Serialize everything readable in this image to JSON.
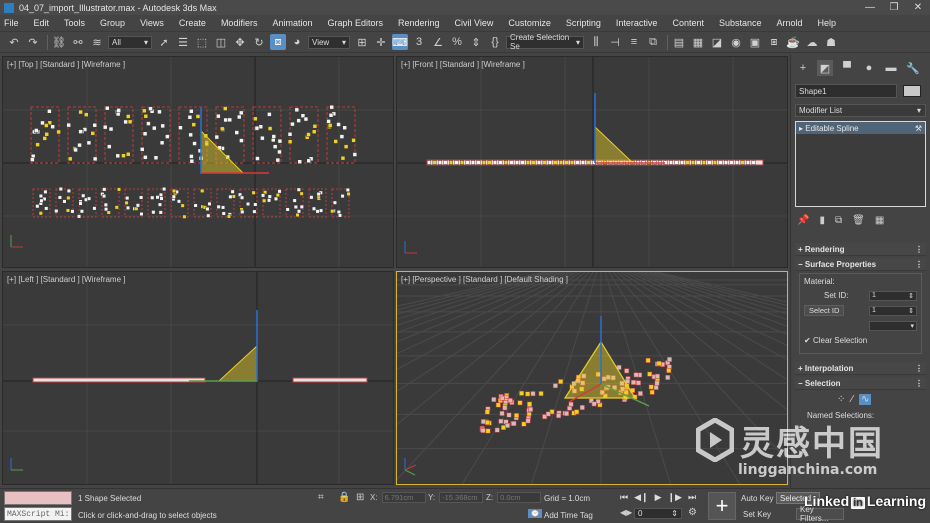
{
  "window": {
    "title": "04_07_import_Illustrator.max - Autodesk 3ds Max",
    "min": "—",
    "restore": "❐",
    "close": "✕"
  },
  "menu": [
    "File",
    "Edit",
    "Tools",
    "Group",
    "Views",
    "Create",
    "Modifiers",
    "Animation",
    "Graph Editors",
    "Rendering",
    "Civil View",
    "Customize",
    "Scripting",
    "Interactive",
    "Content",
    "Substance",
    "Arnold",
    "Help"
  ],
  "toolbar": {
    "filter": "All",
    "refcoord": "View",
    "selection_set": "Create Selection Se"
  },
  "viewports": {
    "top": "[+] [Top ] [Standard ] [Wireframe ]",
    "front": "[+] [Front ] [Standard ] [Wireframe ]",
    "left": "[+] [Left ] [Standard ] [Wireframe ]",
    "persp": "[+] [Perspective ] [Standard ] [Default Shading ]"
  },
  "command_panel": {
    "object_name": "Shape1",
    "modifier_list": "Modifier List",
    "stack_item": "Editable Spline",
    "rollouts": {
      "rendering": "Rendering",
      "surface": "Surface Properties",
      "interpolation": "Interpolation",
      "selection": "Selection"
    },
    "material_label": "Material:",
    "set_id_label": "Set ID:",
    "set_id_value": "1",
    "select_id_label": "Select ID",
    "select_id_value": "1",
    "clear_selection": "Clear Selection",
    "named_selections": "Named Selections:"
  },
  "status": {
    "maxscript": "MAXScript Mi:",
    "line1": "1 Shape Selected",
    "line2": "Click or click-and-drag to select objects",
    "x_label": "X:",
    "x_value": "6.791cm",
    "y_label": "Y:",
    "y_value": "-15.368cm",
    "z_label": "Z:",
    "z_value": "0.0cm",
    "grid": "Grid = 1.0cm",
    "add_time_tag": "Add Time Tag",
    "frame": "0",
    "auto_key": "Auto Key",
    "set_key": "Set Key",
    "selected": "Selected",
    "key_filters": "Key Filters..."
  },
  "watermark": {
    "cn": "灵感中国",
    "domain": "lingganchina.com",
    "linkedin_a": "Linked",
    "linkedin_in": "in",
    "linkedin_b": "Learning"
  },
  "colors": {
    "spline_red": "#c23a3a",
    "vertex": "#f2f2f2",
    "selected_vertex": "#f0d020",
    "gizmo_yellow": "#e8d028",
    "active_border": "#d8b52e"
  }
}
